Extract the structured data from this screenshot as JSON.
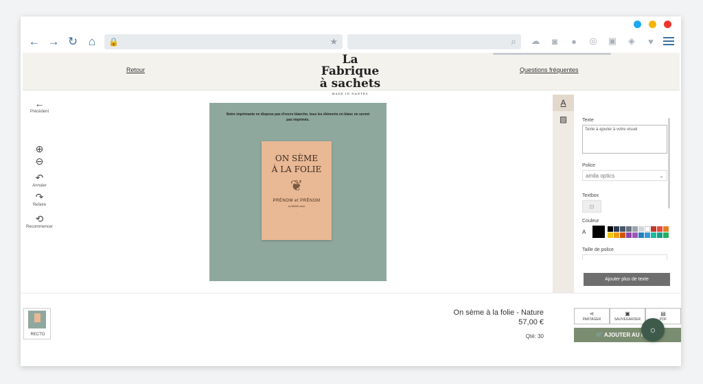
{
  "window_dots": [
    "#1aa8f0",
    "#f5b400",
    "#f0352c"
  ],
  "browser": {
    "nav_icons": [
      "←",
      "→",
      "↻",
      "⌂"
    ],
    "url_lock_icon": "🔒",
    "bookmark_icon": "★",
    "search_icon": "⌕",
    "extension_icons": [
      "☁",
      "◙",
      "●",
      "◎",
      "▣",
      "◈",
      "♥"
    ]
  },
  "header": {
    "back_link": "Retour",
    "faq_link": "Questions fréquentes",
    "logo_line1": "La Fabrique",
    "logo_line2": "à sachets",
    "logo_tagline": "MADE IN NANTES"
  },
  "tools": {
    "previous": {
      "icon": "←",
      "label": "Précédent"
    },
    "zoom_in": {
      "icon": "⊕"
    },
    "zoom_out": {
      "icon": "⊖"
    },
    "undo": {
      "icon": "↶",
      "label": "Annuler"
    },
    "redo": {
      "icon": "↷",
      "label": "Refaire"
    },
    "restart": {
      "icon": "⟲",
      "label": "Recommencer"
    }
  },
  "canvas": {
    "notice": "Notre imprimante ne dispose pas d'encre blanche, tous les éléments en blanc ne seront pas imprimés.",
    "card_title_line1": "ON SÈME",
    "card_title_line2": "À LA FOLIE",
    "card_sprig": "❦",
    "card_names": "PRÉNOM et PRÉNOM",
    "card_date": "xx MOIS xxxx",
    "card_small_text": "..."
  },
  "side_tabs": {
    "text_icon": "A",
    "image_icon": "▨"
  },
  "panel": {
    "texte_label": "Texte",
    "texte_placeholder": "Texte à ajouter à votre visuel",
    "police_label": "Police",
    "police_value": "amila optics",
    "police_chevron": "⌄",
    "textbox_label": "Textbox",
    "textbox_icon": "⊡",
    "couleur_label": "Couleur",
    "couleur_letter": "A",
    "swatches": [
      "#000000",
      "#2b3a55",
      "#4a5568",
      "#6b7280",
      "#9ca3af",
      "#d1d5db",
      "#ffffff",
      "#c0392b",
      "#e74c3c",
      "#e67e22",
      "#f1c40f",
      "#f39c12",
      "#d35400",
      "#8e44ad",
      "#9b59b6",
      "#2980b9",
      "#3498db",
      "#1abc9c",
      "#16a085",
      "#27ae60"
    ],
    "taille_label": "Taille de police",
    "add_text_button": "Ajouter plus de texte"
  },
  "footer": {
    "thumb_label": "RECTO",
    "product_name": "On sème à la folie - Nature",
    "price": "57,00 €",
    "quantity": "Qté: 30",
    "share": {
      "icon": "⋖",
      "label": "PARTAGER"
    },
    "save": {
      "icon": "▣",
      "label": "SAUVEGARDER"
    },
    "pdf": {
      "icon": "▤",
      "label": "PDF"
    },
    "cart_button": "🛒 AJOUTER AU P",
    "chat_icon": "○"
  }
}
